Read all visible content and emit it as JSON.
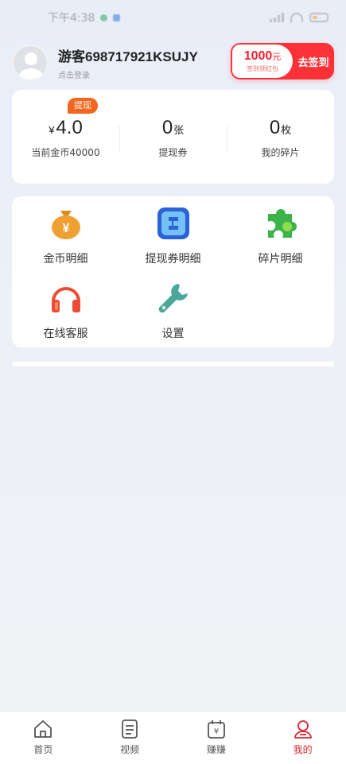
{
  "status_bar": {
    "time": "下午4:38"
  },
  "header": {
    "username": "游客698717921KSUJY",
    "login_hint": "点击登录",
    "checkin": {
      "amount": "1000",
      "amount_unit": "元",
      "sub": "签到领红包",
      "button": "去签到"
    }
  },
  "stats": {
    "badge": "提现",
    "coins": {
      "currency": "¥",
      "value": "4.0",
      "label": "当前金币40000"
    },
    "coupons": {
      "value": "0",
      "unit": "张",
      "label": "提现券"
    },
    "fragments": {
      "value": "0",
      "unit": "枚",
      "label": "我的碎片"
    }
  },
  "menu": {
    "items": [
      {
        "label": "金币明细",
        "icon": "money-bag-icon"
      },
      {
        "label": "提现券明细",
        "icon": "ticket-icon"
      },
      {
        "label": "碎片明细",
        "icon": "puzzle-icon"
      },
      {
        "label": "在线客服",
        "icon": "headphones-icon"
      },
      {
        "label": "设置",
        "icon": "wrench-icon"
      }
    ]
  },
  "nav": {
    "items": [
      {
        "label": "首页",
        "icon": "home-icon"
      },
      {
        "label": "视频",
        "icon": "document-icon"
      },
      {
        "label": "赚赚",
        "icon": "wallet-icon"
      },
      {
        "label": "我的",
        "icon": "profile-icon"
      }
    ],
    "active": "我的"
  },
  "colors": {
    "accent": "#e0242d",
    "badge": "#f4651e",
    "checkin_bg": "#ff3036"
  }
}
